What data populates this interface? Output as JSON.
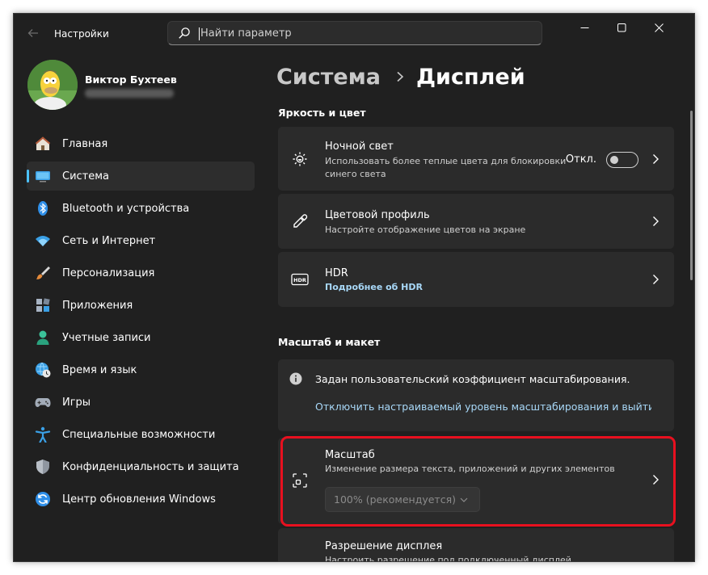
{
  "window": {
    "app_title": "Настройки",
    "back_icon": "arrow-left-icon",
    "search_placeholder": "Найти параметр",
    "controls": [
      "minimize-icon",
      "maximize-icon",
      "close-icon"
    ]
  },
  "profile": {
    "name": "Виктор Бухтеев",
    "avatar_icon": "user-avatar"
  },
  "sidebar": {
    "items": [
      {
        "label": "Главная",
        "icon": "home-icon",
        "active": false
      },
      {
        "label": "Система",
        "icon": "monitor-icon",
        "active": true
      },
      {
        "label": "Bluetooth и устройства",
        "icon": "bluetooth-icon",
        "active": false
      },
      {
        "label": "Сеть и Интернет",
        "icon": "wifi-icon",
        "active": false
      },
      {
        "label": "Персонализация",
        "icon": "brush-icon",
        "active": false
      },
      {
        "label": "Приложения",
        "icon": "apps-icon",
        "active": false
      },
      {
        "label": "Учетные записи",
        "icon": "person-icon",
        "active": false
      },
      {
        "label": "Время и язык",
        "icon": "globe-clock-icon",
        "active": false
      },
      {
        "label": "Игры",
        "icon": "gamepad-icon",
        "active": false
      },
      {
        "label": "Специальные возможности",
        "icon": "accessibility-icon",
        "active": false
      },
      {
        "label": "Конфиденциальность и защита",
        "icon": "shield-icon",
        "active": false
      },
      {
        "label": "Центр обновления Windows",
        "icon": "update-icon",
        "active": false
      }
    ],
    "accent_color": "#4cc2ff"
  },
  "main": {
    "breadcrumb": {
      "parent": "Система",
      "current": "Дисплей"
    },
    "sections": {
      "brightness": "Яркость и цвет",
      "scale_layout": "Масштаб и макет"
    },
    "night_light": {
      "title": "Ночной свет",
      "subtitle": "Использовать более теплые цвета для блокировки синего света",
      "toggle_label": "Откл.",
      "toggle_on": false,
      "icon": "brightness-icon"
    },
    "color_profile": {
      "title": "Цветовой профиль",
      "subtitle": "Настройте отображение цветов на экране",
      "icon": "eyedropper-icon"
    },
    "hdr": {
      "title": "HDR",
      "link": "Подробнее об HDR",
      "icon": "hdr-icon"
    },
    "custom_scale_info": {
      "text": "Задан пользовательский коэффициент масштабирования.",
      "link": "Отключить настраиваемый уровень масштабирования и выйти и",
      "icon": "info-icon"
    },
    "scale": {
      "title": "Масштаб",
      "subtitle": "Изменение размера текста, приложений и других элементов",
      "value": "100% (рекомендуется)",
      "icon": "scale-frame-icon"
    },
    "resolution": {
      "title": "Разрешение дисплея",
      "subtitle": "Настроить разрешение под подключенный дисплей"
    },
    "highlight_color": "#e8101f"
  }
}
